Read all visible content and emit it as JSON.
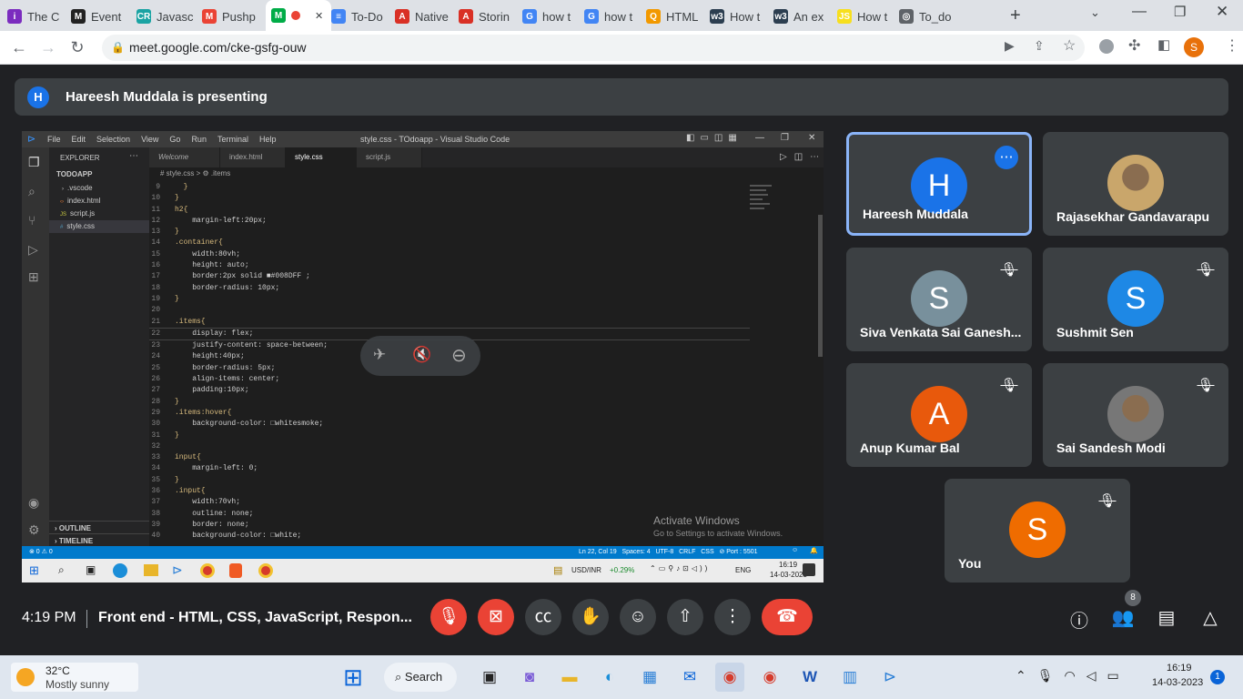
{
  "browser": {
    "tabs": [
      {
        "title": "The C",
        "fav": "i",
        "color": "#7b2cbf"
      },
      {
        "title": "Event",
        "fav": "M",
        "color": "#222222"
      },
      {
        "title": "Javasc",
        "fav": "CR",
        "color": "#1aa3a3"
      },
      {
        "title": "Pushp",
        "fav": "M",
        "color": "#ea4335"
      },
      {
        "title": "",
        "fav": "M",
        "color": "#00ac47",
        "active": true
      },
      {
        "title": "To-Do",
        "fav": "≡",
        "color": "#4285f4"
      },
      {
        "title": "Native",
        "fav": "A",
        "color": "#d93025"
      },
      {
        "title": "Storin",
        "fav": "A",
        "color": "#d93025"
      },
      {
        "title": "how t",
        "fav": "G",
        "color": "#4285f4"
      },
      {
        "title": "how t",
        "fav": "G",
        "color": "#4285f4"
      },
      {
        "title": "HTML",
        "fav": "Q",
        "color": "#f29900"
      },
      {
        "title": "How t",
        "fav": "w3",
        "color": "#2c3e50"
      },
      {
        "title": "An ex",
        "fav": "w3",
        "color": "#2c3e50"
      },
      {
        "title": "How t",
        "fav": "JS",
        "color": "#f7df1e"
      },
      {
        "title": "To_do",
        "fav": "◎",
        "color": "#5f6368"
      }
    ],
    "url": "meet.google.com/cke-gsfg-ouw",
    "profile_initial": "S"
  },
  "presenting": {
    "initial": "H",
    "text": "Hareesh Muddala is presenting"
  },
  "vscode": {
    "menu": [
      "File",
      "Edit",
      "Selection",
      "View",
      "Go",
      "Run",
      "Terminal",
      "Help"
    ],
    "title": "style.css - TOdoapp - Visual Studio Code",
    "explorer_label": "EXPLORER",
    "project": "TODOAPP",
    "files": [
      ".vscode",
      "index.html",
      "script.js",
      "style.css"
    ],
    "outline": "OUTLINE",
    "timeline": "TIMELINE",
    "tabs": [
      "Welcome",
      "index.html",
      "style.css",
      "script.js"
    ],
    "breadcrumb": "# style.css > ⚙ .items",
    "code": [
      {
        "n": "9",
        "t": "  }"
      },
      {
        "n": "10",
        "t": "}"
      },
      {
        "n": "11",
        "t": "h2{"
      },
      {
        "n": "12",
        "t": "    margin-left:20px;"
      },
      {
        "n": "13",
        "t": "}"
      },
      {
        "n": "14",
        "t": ".container{"
      },
      {
        "n": "15",
        "t": "    width:80vh;"
      },
      {
        "n": "16",
        "t": "    height: auto;"
      },
      {
        "n": "17",
        "t": "    border:2px solid ■#008DFF ;"
      },
      {
        "n": "18",
        "t": "    border-radius: 10px;"
      },
      {
        "n": "19",
        "t": "}"
      },
      {
        "n": "20",
        "t": ""
      },
      {
        "n": "21",
        "t": ".items{"
      },
      {
        "n": "22",
        "t": "    display: flex;"
      },
      {
        "n": "23",
        "t": "    justify-content: space-between;"
      },
      {
        "n": "24",
        "t": "    height:40px;"
      },
      {
        "n": "25",
        "t": "    border-radius: 5px;"
      },
      {
        "n": "26",
        "t": "    align-items: center;"
      },
      {
        "n": "27",
        "t": "    padding:10px;"
      },
      {
        "n": "28",
        "t": "}"
      },
      {
        "n": "29",
        "t": ".items:hover{"
      },
      {
        "n": "30",
        "t": "    background-color: □whitesmoke;"
      },
      {
        "n": "31",
        "t": "}"
      },
      {
        "n": "32",
        "t": ""
      },
      {
        "n": "33",
        "t": "input{"
      },
      {
        "n": "34",
        "t": "    margin-left: 0;"
      },
      {
        "n": "35",
        "t": "}"
      },
      {
        "n": "36",
        "t": ".input{"
      },
      {
        "n": "37",
        "t": "    width:70vh;"
      },
      {
        "n": "38",
        "t": "    outline: none;"
      },
      {
        "n": "39",
        "t": "    border: none;"
      },
      {
        "n": "40",
        "t": "    background-color: □white;"
      }
    ],
    "activate_title": "Activate Windows",
    "activate_sub": "Go to Settings to activate Windows.",
    "status_left": "⊗ 0 ⚠ 0",
    "status_right": "Ln 22, Col 19   Spaces: 4   UTF-8   CRLF   CSS   ⊘ Port : 5501",
    "taskbar_ticker": "USD/INR",
    "taskbar_change": "+0.29%",
    "taskbar_lang": "ENG",
    "taskbar_time": "16:19",
    "taskbar_date": "14-03-2023"
  },
  "participants": [
    {
      "name": "Hareesh Muddala",
      "initial": "H",
      "color": "#1a73e8",
      "speaking": true,
      "muted": false
    },
    {
      "name": "Rajasekhar Gandavarapu",
      "initial": "",
      "color": "#c9a66b",
      "muted": false,
      "photo": true
    },
    {
      "name": "Siva Venkata Sai Ganesh...",
      "initial": "S",
      "color": "#78909c",
      "muted": true
    },
    {
      "name": "Sushmit Sen",
      "initial": "S",
      "color": "#1e88e5",
      "muted": true
    },
    {
      "name": "Anup Kumar Bal",
      "initial": "A",
      "color": "#e8590c",
      "muted": true
    },
    {
      "name": "Sai Sandesh Modi",
      "initial": "",
      "color": "#777777",
      "muted": true,
      "photo": true
    },
    {
      "name": "You",
      "initial": "S",
      "color": "#ef6c00",
      "muted": true
    }
  ],
  "meeting": {
    "time": "4:19 PM",
    "title": "Front end - HTML, CSS, JavaScript, Respon...",
    "participant_count": "8"
  },
  "taskbar": {
    "weather_temp": "32°C",
    "weather_desc": "Mostly sunny",
    "search_label": "Search",
    "time": "16:19",
    "date": "14-03-2023",
    "notification_count": "1"
  }
}
